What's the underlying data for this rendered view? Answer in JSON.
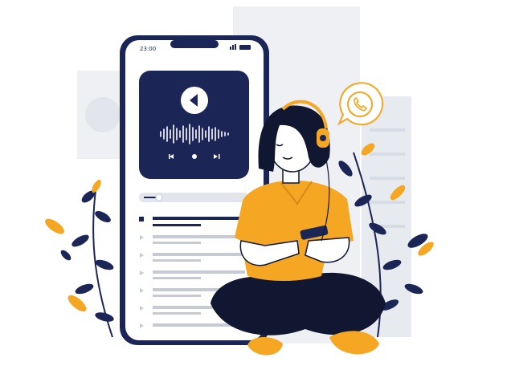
{
  "phone": {
    "status_time": "23:00",
    "player": {
      "progress_fraction": 0.12
    },
    "playlist": {
      "item_count": 7
    }
  },
  "colors": {
    "navy": "#1b2657",
    "orange": "#f5a623",
    "lightgray": "#e9ecf1",
    "midgray": "#d7dbe3",
    "skin": "#ffffff"
  },
  "icons": [
    "play-icon",
    "previous-icon",
    "next-icon",
    "bluetooth-icon",
    "phone-call-icon",
    "headphones-icon"
  ]
}
